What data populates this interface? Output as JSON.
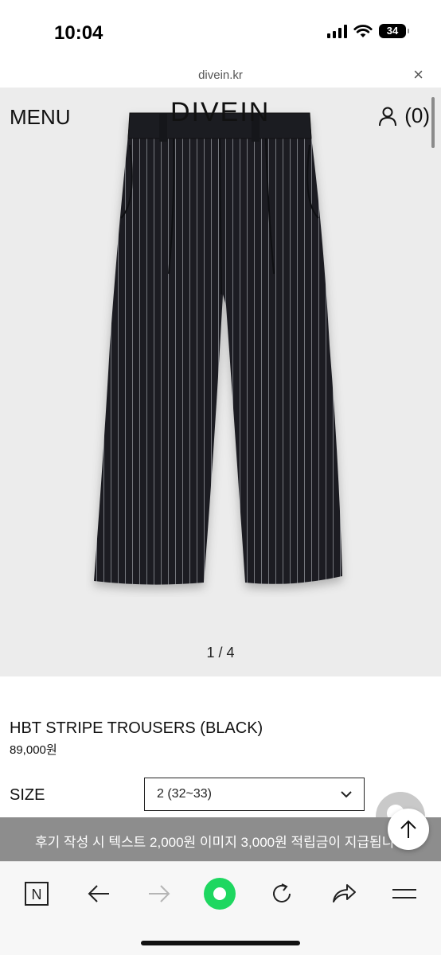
{
  "status_bar": {
    "time": "10:04",
    "battery": "34"
  },
  "url_bar": {
    "domain": "divein.kr",
    "close_icon": "close-icon"
  },
  "header": {
    "menu_label": "MENU",
    "brand": "DIVEIN",
    "cart_count": "(0)",
    "account_icon": "user-icon"
  },
  "gallery": {
    "counter": "1 / 4"
  },
  "product": {
    "name": "HBT STRIPE TROUSERS (BLACK)",
    "price": "89,000원",
    "size_label": "SIZE",
    "size_selected": "2 (32~33)"
  },
  "banner": {
    "text": "후기 작성 시 텍스트 2,000원 이미지 3,000원 적립금이 지급됩니다"
  },
  "toolbar": {
    "icons": [
      "naver-n-icon",
      "back-arrow-icon",
      "forward-arrow-icon",
      "green-dot-icon",
      "reload-icon",
      "share-icon",
      "menu-icon"
    ],
    "naver_letter": "N"
  },
  "colors": {
    "accent_green": "#1ed760",
    "hero_bg": "#ececec",
    "banner_bg": "#8d8d8d"
  }
}
